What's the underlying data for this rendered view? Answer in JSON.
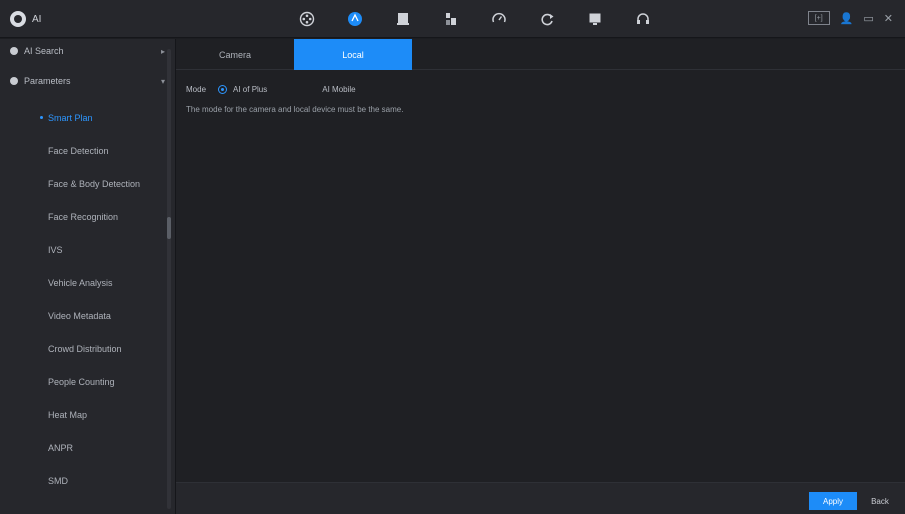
{
  "top": {
    "brand_label": "AI",
    "nav": [
      {
        "icon": "film-reel-icon"
      },
      {
        "icon": "ai-bulb-icon",
        "active": true
      },
      {
        "icon": "camera-icon"
      },
      {
        "icon": "storage-icon"
      },
      {
        "icon": "dashboard-icon"
      },
      {
        "icon": "refresh-icon"
      },
      {
        "icon": "display-icon"
      },
      {
        "icon": "headset-icon"
      }
    ],
    "right_box_label": "[+]",
    "right_icons": [
      "user-icon",
      "window-icon",
      "close-icon"
    ],
    "accent": "#1d8cf8"
  },
  "sidebar": {
    "headers": [
      {
        "label": "AI Search"
      },
      {
        "label": "Parameters"
      }
    ],
    "items": [
      {
        "label": "Smart Plan",
        "active": true
      },
      {
        "label": "Face Detection"
      },
      {
        "label": "Face & Body Detection"
      },
      {
        "label": "Face Recognition"
      },
      {
        "label": "IVS"
      },
      {
        "label": "Vehicle Analysis"
      },
      {
        "label": "Video Metadata"
      },
      {
        "label": "Crowd Distribution"
      },
      {
        "label": "People Counting"
      },
      {
        "label": "Heat Map"
      },
      {
        "label": "ANPR"
      },
      {
        "label": "SMD"
      }
    ]
  },
  "main": {
    "tabs": [
      {
        "label": "Camera"
      },
      {
        "label": "Local",
        "active": true
      }
    ],
    "mode_label": "Mode",
    "mode_options": [
      {
        "label": "AI of Plus",
        "selected": true
      },
      {
        "label": "AI Mobile",
        "selected": false
      }
    ],
    "note": "The mode for the camera and local device must be the same."
  },
  "footer": {
    "apply": "Apply",
    "back": "Back"
  }
}
